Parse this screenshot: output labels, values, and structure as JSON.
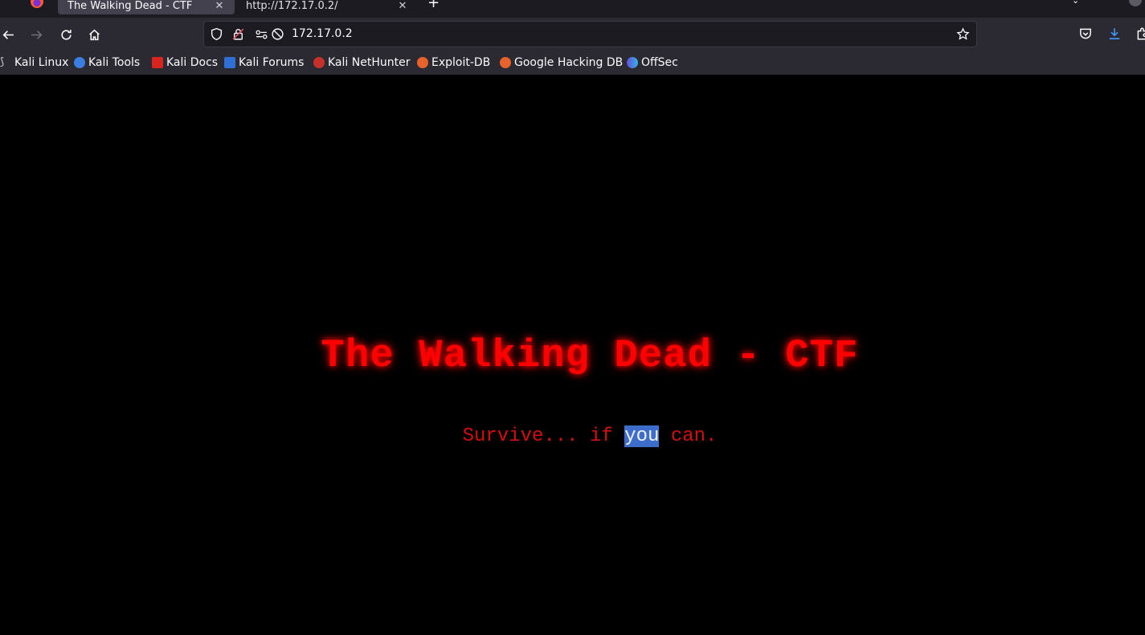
{
  "browser": {
    "tabs": [
      {
        "label": "The Walking Dead - CTF",
        "active": true
      },
      {
        "label": "http://172.17.0.2/",
        "active": false
      }
    ],
    "url": "172.17.0.2",
    "bookmarks": [
      {
        "label": "Kali Linux",
        "icon": "kali-dragon-icon"
      },
      {
        "label": "Kali Tools",
        "icon": "kali-tools-icon"
      },
      {
        "label": "Kali Docs",
        "icon": "kali-docs-icon"
      },
      {
        "label": "Kali Forums",
        "icon": "kali-forums-icon"
      },
      {
        "label": "Kali NetHunter",
        "icon": "kali-nethunter-icon"
      },
      {
        "label": "Exploit-DB",
        "icon": "exploit-db-icon"
      },
      {
        "label": "Google Hacking DB",
        "icon": "ghdb-icon"
      },
      {
        "label": "OffSec",
        "icon": "offsec-icon"
      }
    ]
  },
  "page": {
    "title": "The Walking Dead - CTF",
    "subtitle_pre": "Survive... if ",
    "subtitle_selected": "you",
    "subtitle_post": " can."
  },
  "colors": {
    "title": "#ff0000",
    "subtitle": "#d40d0d",
    "selection": "#3d6ecb",
    "chrome": "#2b2a33"
  }
}
